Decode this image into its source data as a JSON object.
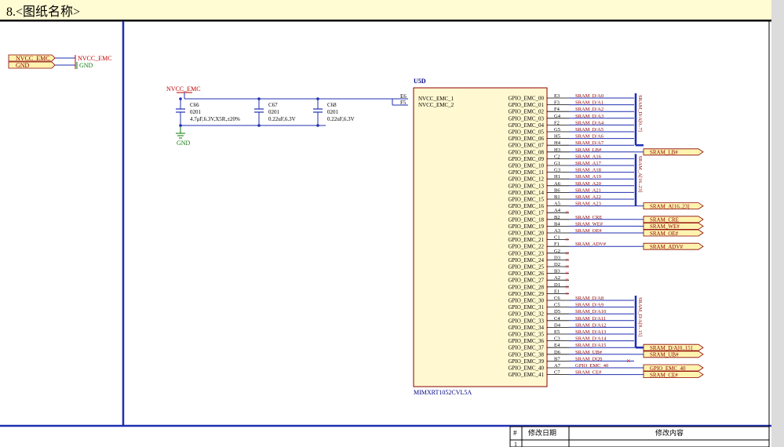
{
  "title": "8.<图纸名称>",
  "colors": {
    "wire": "#1f2fb0",
    "label": "#8b0000",
    "pin": "#000000",
    "port_fill": "#fff3b0",
    "part_fill": "#fff8d0",
    "noconnect": "#e02020",
    "power": "#c00000",
    "gnd": "#0a7a0a"
  },
  "legend": {
    "port1": "NVCC_EMC",
    "port2": "GND",
    "net_vcc": "NVCC_EMC",
    "net_gnd": "GND"
  },
  "power": {
    "vcc": "NVCC_EMC",
    "gnd": "GND"
  },
  "capacitors": [
    {
      "ref": "C66",
      "pkg": "0201",
      "value": "4.7μF,6.3V,X5R,±20%"
    },
    {
      "ref": "C67",
      "pkg": "0201",
      "value": "0.22uF,6.3V"
    },
    {
      "ref": "C68",
      "pkg": "0201",
      "value": "0.22uF,6.3V"
    }
  ],
  "component": {
    "ref": "U5D",
    "part": "MIMXRT1052CVL5A",
    "left_pins": [
      {
        "name": "NVCC_EMC_1",
        "num": "E6"
      },
      {
        "name": "NVCC_EMC_2",
        "num": "F5"
      }
    ],
    "right_pins": [
      {
        "name": "GPIO_EMC_00",
        "num": "E3",
        "net": "SRAM_D/A0"
      },
      {
        "name": "GPIO_EMC_01",
        "num": "F3",
        "net": "SRAM_D/A1"
      },
      {
        "name": "GPIO_EMC_02",
        "num": "F4",
        "net": "SRAM_D/A2"
      },
      {
        "name": "GPIO_EMC_03",
        "num": "G4",
        "net": "SRAM_D/A3"
      },
      {
        "name": "GPIO_EMC_04",
        "num": "F2",
        "net": "SRAM_D/A4"
      },
      {
        "name": "GPIO_EMC_05",
        "num": "G5",
        "net": "SRAM_D/A5"
      },
      {
        "name": "GPIO_EMC_06",
        "num": "H5",
        "net": "SRAM_D/A6"
      },
      {
        "name": "GPIO_EMC_07",
        "num": "H4",
        "net": "SRAM_D/A7"
      },
      {
        "name": "GPIO_EMC_08",
        "num": "H3",
        "net": "SRAM_LB#"
      },
      {
        "name": "GPIO_EMC_09",
        "num": "C2",
        "net": "SRAM_A16"
      },
      {
        "name": "GPIO_EMC_10",
        "num": "G1",
        "net": "SRAM_A17"
      },
      {
        "name": "GPIO_EMC_11",
        "num": "G3",
        "net": "SRAM_A18"
      },
      {
        "name": "GPIO_EMC_12",
        "num": "H1",
        "net": "SRAM_A19"
      },
      {
        "name": "GPIO_EMC_13",
        "num": "A6",
        "net": "SRAM_A20"
      },
      {
        "name": "GPIO_EMC_14",
        "num": "B6",
        "net": "SRAM_A21"
      },
      {
        "name": "GPIO_EMC_15",
        "num": "B1",
        "net": "SRAM_A22"
      },
      {
        "name": "GPIO_EMC_16",
        "num": "A5",
        "net": "SRAM_A23"
      },
      {
        "name": "GPIO_EMC_17",
        "num": "A4",
        "net": ""
      },
      {
        "name": "GPIO_EMC_18",
        "num": "B2",
        "net": "SRAM_CRE"
      },
      {
        "name": "GPIO_EMC_19",
        "num": "B4",
        "net": "SRAM_WE#"
      },
      {
        "name": "GPIO_EMC_20",
        "num": "A3",
        "net": "SRAM_OE#"
      },
      {
        "name": "GPIO_EMC_21",
        "num": "C1",
        "net": ""
      },
      {
        "name": "GPIO_EMC_22",
        "num": "F1",
        "net": "SRAM_ADV#"
      },
      {
        "name": "GPIO_EMC_23",
        "num": "G2",
        "net": ""
      },
      {
        "name": "GPIO_EMC_24",
        "num": "D3",
        "net": ""
      },
      {
        "name": "GPIO_EMC_25",
        "num": "D2",
        "net": ""
      },
      {
        "name": "GPIO_EMC_26",
        "num": "B3",
        "net": ""
      },
      {
        "name": "GPIO_EMC_27",
        "num": "A2",
        "net": ""
      },
      {
        "name": "GPIO_EMC_28",
        "num": "D1",
        "net": ""
      },
      {
        "name": "GPIO_EMC_29",
        "num": "E1",
        "net": ""
      },
      {
        "name": "GPIO_EMC_30",
        "num": "C6",
        "net": "SRAM_D/A8"
      },
      {
        "name": "GPIO_EMC_31",
        "num": "C5",
        "net": "SRAM_D/A9"
      },
      {
        "name": "GPIO_EMC_32",
        "num": "D5",
        "net": "SRAM_D/A10"
      },
      {
        "name": "GPIO_EMC_33",
        "num": "C4",
        "net": "SRAM_D/A11"
      },
      {
        "name": "GPIO_EMC_34",
        "num": "D4",
        "net": "SRAM_D/A12"
      },
      {
        "name": "GPIO_EMC_35",
        "num": "E5",
        "net": "SRAM_D/A13"
      },
      {
        "name": "GPIO_EMC_36",
        "num": "C3",
        "net": "SRAM_D/A14"
      },
      {
        "name": "GPIO_EMC_37",
        "num": "E4",
        "net": "SRAM_D/A15"
      },
      {
        "name": "GPIO_EMC_38",
        "num": "D6",
        "net": "SRAM_UB#"
      },
      {
        "name": "GPIO_EMC_39",
        "num": "B7",
        "net": "SRAM_DQS"
      },
      {
        "name": "GPIO_EMC_40",
        "num": "A7",
        "net": "GPIO_EMC_40"
      },
      {
        "name": "GPIO_EMC_41",
        "num": "C7",
        "net": "SRAM_CE#"
      }
    ]
  },
  "buses": [
    {
      "label": "SRAM_D/A[0..7]",
      "from": 0,
      "to": 7
    },
    {
      "label": "SRAM_A[16..23]",
      "from": 9,
      "to": 16
    },
    {
      "label": "SRAM_D/A[8..15]",
      "from": 30,
      "to": 37
    }
  ],
  "ports": [
    {
      "label": "SRAM_LB#",
      "row": 8
    },
    {
      "label": "SRAM_A[16..23]",
      "row": 16
    },
    {
      "label": "SRAM_CRE",
      "row": 18
    },
    {
      "label": "SRAM_WE#",
      "row": 19
    },
    {
      "label": "SRAM_OE#",
      "row": 20
    },
    {
      "label": "SRAM_ADV#",
      "row": 22
    },
    {
      "label": "SRAM_D/A[0..15]",
      "row": 37
    },
    {
      "label": "SRAM_UB#",
      "row": 38
    },
    {
      "label": "GPIO_EMC_40",
      "row": 40
    },
    {
      "label": "SRAM_CE#",
      "row": 41
    }
  ],
  "dqs_noconnect_row": 39,
  "revision_table": {
    "headers": [
      "#",
      "修改日期",
      "修改内容"
    ],
    "rows": [
      [
        "1",
        "",
        ""
      ]
    ]
  }
}
